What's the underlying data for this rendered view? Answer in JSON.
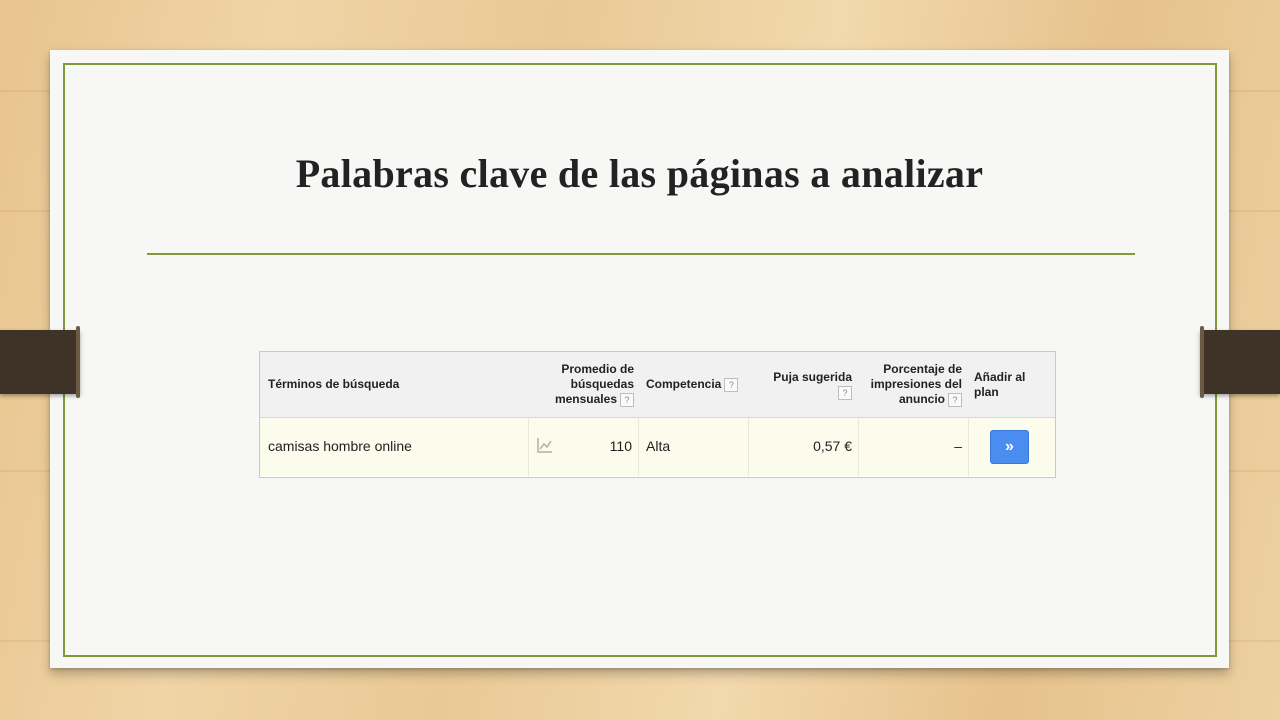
{
  "slide": {
    "title": "Palabras clave de las páginas a analizar"
  },
  "keyword_table": {
    "headers": {
      "terms": "Términos de búsqueda",
      "avg_searches_1": "Promedio de",
      "avg_searches_2": "búsquedas",
      "avg_searches_3": "mensuales",
      "competition": "Competencia",
      "bid": "Puja sugerida",
      "impressions_1": "Porcentaje de",
      "impressions_2": "impresiones del",
      "impressions_3": "anuncio",
      "add_1": "Añadir al",
      "add_2": "plan"
    },
    "help_glyph": "?",
    "rows": [
      {
        "term": "camisas hombre online",
        "avg_searches": "110",
        "competition": "Alta",
        "bid": "0,57 €",
        "impressions": "–",
        "add_glyph": "»"
      }
    ]
  },
  "colors": {
    "accent_green": "#7f9a36",
    "button_blue": "#4a8cf0",
    "row_highlight": "#fbfcec"
  },
  "icons": [
    "trend-chart-icon",
    "help-icon",
    "add-to-plan-icon"
  ]
}
